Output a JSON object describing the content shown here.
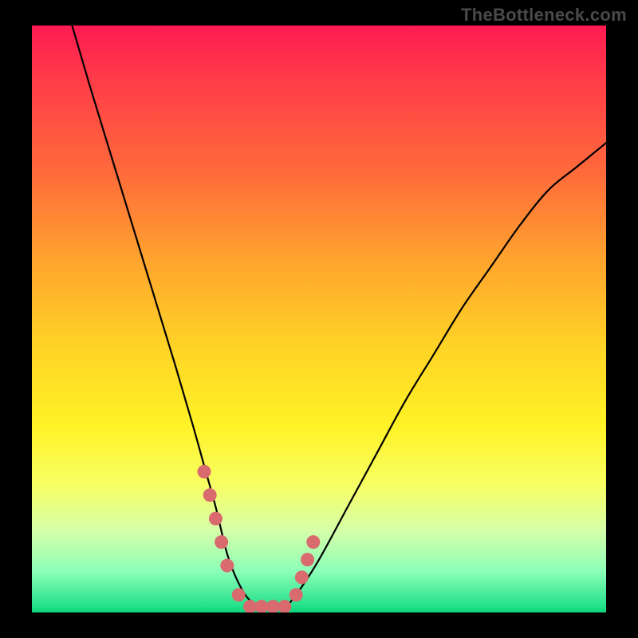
{
  "attribution": "TheBottleneck.com",
  "chart_data": {
    "type": "line",
    "title": "",
    "xlabel": "",
    "ylabel": "",
    "xlim": [
      0,
      100
    ],
    "ylim": [
      0,
      100
    ],
    "series": [
      {
        "name": "bottleneck-curve",
        "x": [
          7,
          10,
          15,
          20,
          25,
          28,
          30,
          32,
          34,
          36,
          38,
          40,
          42,
          44,
          46,
          50,
          55,
          60,
          65,
          70,
          75,
          80,
          85,
          90,
          95,
          100
        ],
        "values": [
          100,
          90,
          74,
          58,
          42,
          32,
          25,
          18,
          10,
          5,
          2,
          1,
          1,
          1,
          3,
          9,
          18,
          27,
          36,
          44,
          52,
          59,
          66,
          72,
          76,
          80
        ]
      }
    ],
    "markers": {
      "name": "highlight-points",
      "color": "#d96a6e",
      "x": [
        30,
        31,
        32,
        33,
        34,
        36,
        38,
        40,
        42,
        44,
        46,
        47,
        48,
        49
      ],
      "values": [
        24,
        20,
        16,
        12,
        8,
        3,
        1,
        1,
        1,
        1,
        3,
        6,
        9,
        12
      ]
    }
  }
}
